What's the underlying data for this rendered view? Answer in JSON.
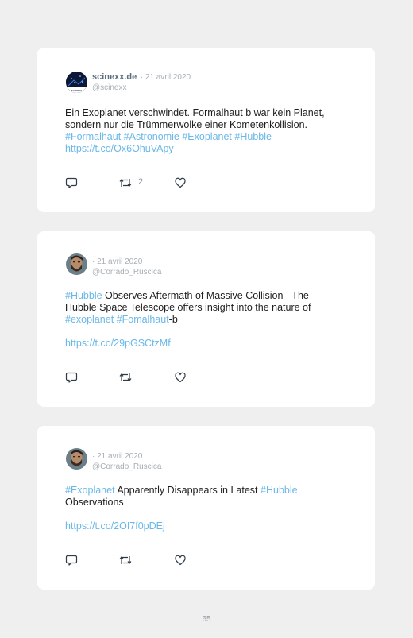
{
  "tweets": [
    {
      "name": "scinexx.de",
      "date": "· 21 avril 2020",
      "handle": "@scinexx",
      "avatar_label": "scinexx",
      "text1": "Ein Exoplanet verschwindet. Formalhaut b war kein Planet,",
      "text2": "sondern nur die Trümmerwolke einer Kometenkollision.",
      "tags": [
        "#Formalhaut",
        "#Astronomie",
        "#Exoplanet",
        "#Hubble"
      ],
      "link": "https://t.co/Ox6OhuVApy",
      "retweet_count": "2"
    },
    {
      "name": "",
      "date": "· 21 avril 2020",
      "handle": "@Corrado_Ruscica",
      "tag_hubble": "#Hubble",
      "text1_rest": " Observes Aftermath of Massive Collision - The",
      "text2": "Hubble Space Telescope offers insight into the nature of",
      "tag_exoplanet": "#exoplanet",
      "tag_fomalhaut": "#Fomalhaut",
      "suffix": "-b",
      "link": "https://t.co/29pGSCtzMf"
    },
    {
      "name": "",
      "date": "· 21 avril 2020",
      "handle": "@Corrado_Ruscica",
      "tag_exoplanet": "#Exoplanet",
      "text_mid": " Apparently Disappears in Latest ",
      "tag_hubble": "#Hubble",
      "text2": "Observations",
      "link": "https://t.co/2OI7f0pDEj"
    }
  ],
  "page_number": "65",
  "colors": {
    "background": "#efeff0",
    "card": "#ffffff",
    "hashtag": "#69b8e8",
    "muted": "#a6aeb6",
    "name": "#5b6e80"
  },
  "icons": [
    "reply-icon",
    "retweet-icon",
    "like-icon"
  ]
}
